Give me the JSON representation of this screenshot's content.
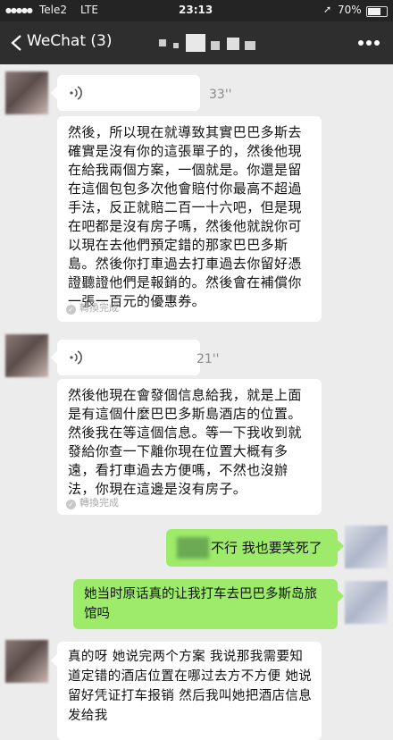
{
  "status_bar": {
    "carrier": "Tele2",
    "network": "LTE",
    "time": "23:13",
    "battery": "70%"
  },
  "header": {
    "back_label": "WeChat (3)",
    "title": "",
    "icons": {
      "back": "chevron-left-icon",
      "more": "more-dots-icon"
    }
  },
  "messages": [
    {
      "side": "left",
      "type": "voice",
      "duration": "33''",
      "transcript": "然後，所以現在就導致其實巴巴多斯去確實是沒有你的這張單子的，然後他現在給我兩個方案，一個就是。你還是留在這個包包多次他會賠付你最高不超過手法，反正就賠二百一十六吧，但是現在吧都是沒有房子嗎，然後他就說你可以現在去他們預定錯的那家巴巴多斯島。然後你打車過去打車過去你留好憑證聽證他們是報銷的。然後會在補償你一張一百元的優惠券。",
      "status": "轉換完成"
    },
    {
      "side": "left",
      "type": "voice",
      "duration": "21''",
      "transcript": "然後他現在會發個信息給我，就是上面是有這個什麼巴巴多斯島酒店的位置。然後我在等這個信息。等一下我收到就發給你查一下離你現在位置大概有多遠，看打車過去方便嗎，不然也沒辦法，你現在這邊是沒有房子。",
      "status": "轉換完成"
    },
    {
      "side": "right",
      "type": "text",
      "text": "不行 我也要笑死了"
    },
    {
      "side": "right",
      "type": "text",
      "text": "她当时原话真的让我打车去巴巴多斯岛旅馆吗"
    },
    {
      "side": "left",
      "type": "text",
      "text": "真的呀 她说完两个方案 我说那我需要知道定错的酒店位置在哪过去方不方便 她说留好凭证打车报销 然后我叫她把酒店信息发给我"
    }
  ],
  "colors": {
    "status_bar_bg": "#242424",
    "nav_bar_bg": "#2e2e2e",
    "chat_bg": "#ececec",
    "sent_bubble": "#9eea6a",
    "received_bubble": "#ffffff"
  }
}
